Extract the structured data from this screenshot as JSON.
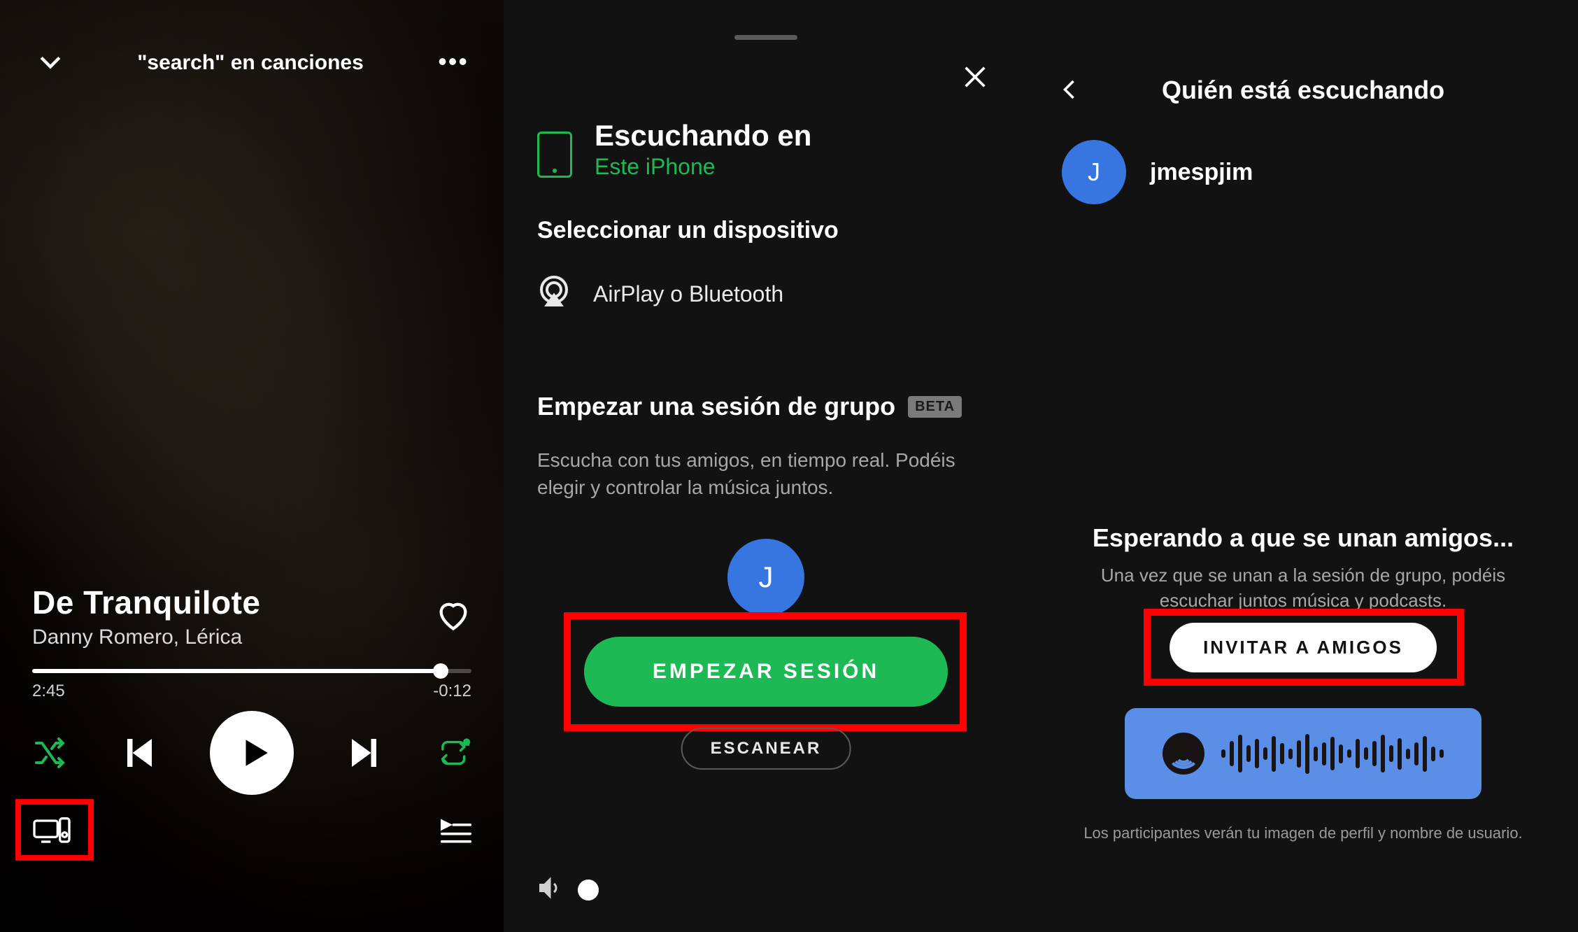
{
  "panel1": {
    "top_title": "\"search\" en canciones",
    "track_title": "De Tranquilote",
    "track_artist": "Danny Romero, Lérica",
    "time_elapsed": "2:45",
    "time_remaining": "-0:12",
    "progress_pct": 93
  },
  "panel2": {
    "listening_label": "Escuchando en",
    "listening_device": "Este iPhone",
    "select_device": "Seleccionar un dispositivo",
    "airplay_label": "AirPlay o Bluetooth",
    "group_title": "Empezar una sesión de grupo",
    "beta": "BETA",
    "group_desc": "Escucha con tus amigos, en tiempo real. Podéis elegir y controlar la música juntos.",
    "avatar_initial": "J",
    "start_label": "EMPEZAR SESIÓN",
    "scan_label": "ESCANEAR"
  },
  "panel3": {
    "title": "Quién está escuchando",
    "avatar_initial": "J",
    "username": "jmespjim",
    "waiting": "Esperando a que se unan amigos...",
    "waiting_desc": "Una vez que se unan a la sesión de grupo, podéis escuchar juntos música y podcasts.",
    "invite_label": "INVITAR A AMIGOS",
    "disclaimer": "Los participantes verán tu imagen de perfil y nombre de usuario."
  },
  "colors": {
    "accent": "#1db954",
    "highlight": "#ff0000",
    "avatar": "#3776e0",
    "code_bg": "#5b8ee6"
  }
}
